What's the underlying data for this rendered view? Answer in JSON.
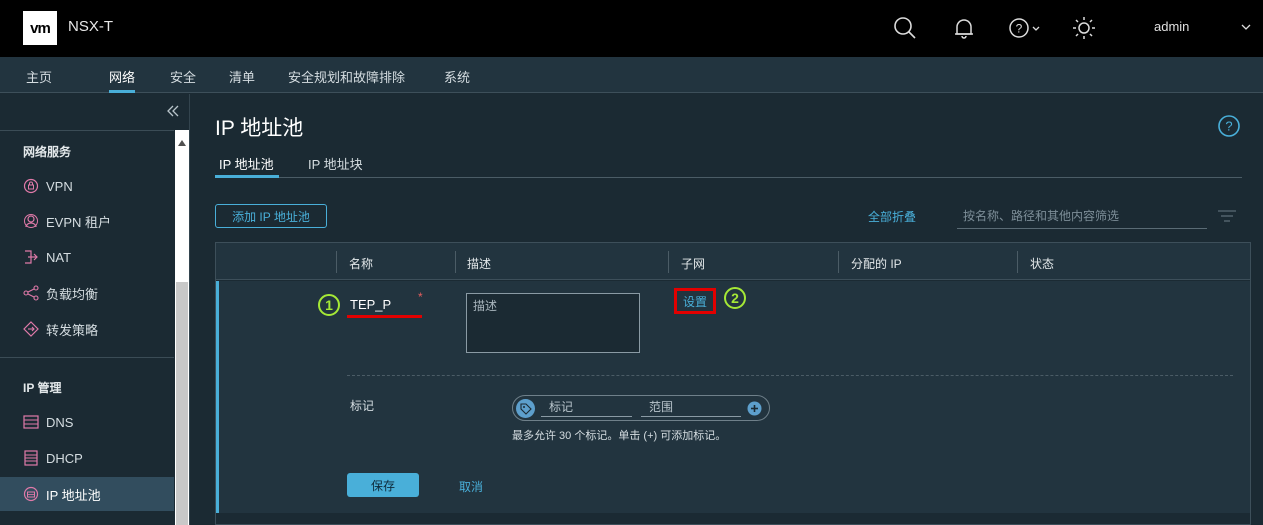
{
  "header": {
    "logo": "vm",
    "product": "NSX-T",
    "user": "admin",
    "icons": [
      "search-icon",
      "bell-icon",
      "help-icon",
      "theme-icon",
      "chevron-down-icon"
    ]
  },
  "nav": {
    "items": [
      "主页",
      "网络",
      "安全",
      "清单",
      "安全规划和故障排除",
      "系统"
    ],
    "active": "网络"
  },
  "sidebar": {
    "sections": [
      {
        "title": "网络服务",
        "items": [
          "VPN",
          "EVPN 租户",
          "NAT",
          "负载均衡",
          "转发策略"
        ]
      },
      {
        "title": "IP 管理",
        "items": [
          "DNS",
          "DHCP",
          "IP 地址池"
        ]
      }
    ],
    "active": "IP 地址池"
  },
  "main": {
    "title": "IP 地址池",
    "tabs": [
      "IP 地址池",
      "IP 地址块"
    ],
    "active_tab": "IP 地址池",
    "add_button": "添加 IP 地址池",
    "collapse_all": "全部折叠",
    "search_placeholder": "按名称、路径和其他内容筛选",
    "columns": [
      "名称",
      "描述",
      "子网",
      "分配的 IP",
      "状态"
    ],
    "edit_row": {
      "name_value": "TEP_P",
      "required_mark": "*",
      "desc_placeholder": "描述",
      "subnet_link": "设置",
      "step1": "1",
      "step2": "2",
      "tags_label": "标记",
      "tag_placeholder": "标记",
      "scope_placeholder": "范围",
      "tag_hint": "最多允许 30 个标记。单击 (+) 可添加标记。",
      "save": "保存",
      "cancel": "取消"
    }
  },
  "colors": {
    "accent": "#49afd9",
    "highlight_red": "#e30000",
    "step_green": "#a5e836",
    "header_bg": "#000000",
    "content_bg": "#1b2a33"
  }
}
